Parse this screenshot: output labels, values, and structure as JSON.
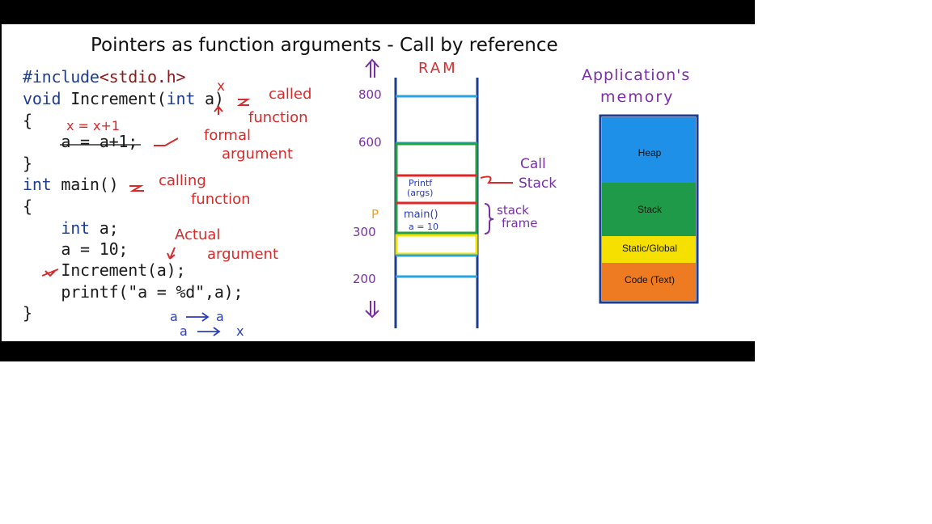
{
  "title": "Pointers as function arguments - Call by reference",
  "code": {
    "line1_kw": "#include",
    "line1_hdr": "<stdio.h>",
    "line2_kw": "void",
    "line2_rest": " Increment(",
    "line2_kw2": "int",
    "line2_end": " a)",
    "line3": "{",
    "line4": "    a = a+1;",
    "line5": "}",
    "line6_kw": "int",
    "line6_rest": " main()",
    "line7": "{",
    "line8_kw": "    int",
    "line8_rest": " a;",
    "line9": "    a = 10;",
    "line10": "    Increment(a);",
    "line11": "    printf(\"a = %d\",a);",
    "line12": "}"
  },
  "annotations": {
    "x_over_a": "x",
    "called": "called",
    "function1": "function",
    "x_eq": "x = x+1",
    "formal": "formal",
    "argument1": "argument",
    "calling": "calling",
    "function2": "function",
    "actual": "Actual",
    "argument2": "argument",
    "map1_left": "a",
    "map1_right": "a",
    "map2_left": "a",
    "map2_right": "x"
  },
  "ram": {
    "label": "RAM",
    "addr_800": "800",
    "addr_600": "600",
    "addr_300": "300",
    "addr_200": "200",
    "p": "P",
    "printf_frame": "Printf",
    "printf_args": "(args)",
    "main_frame": "main()",
    "main_var": "a = 10",
    "call_stack_1": "Call",
    "call_stack_2": "Stack",
    "stack_frame_1": "stack",
    "stack_frame_2": "frame"
  },
  "app_memory": {
    "title_1": "Application's",
    "title_2": "memory",
    "segments": [
      {
        "label": "Heap",
        "color": "#1e90e8"
      },
      {
        "label": "Stack",
        "color": "#1f9a48"
      },
      {
        "label": "Static/Global",
        "color": "#f5e000"
      },
      {
        "label": "Code (Text)",
        "color": "#ee7b22"
      }
    ]
  }
}
